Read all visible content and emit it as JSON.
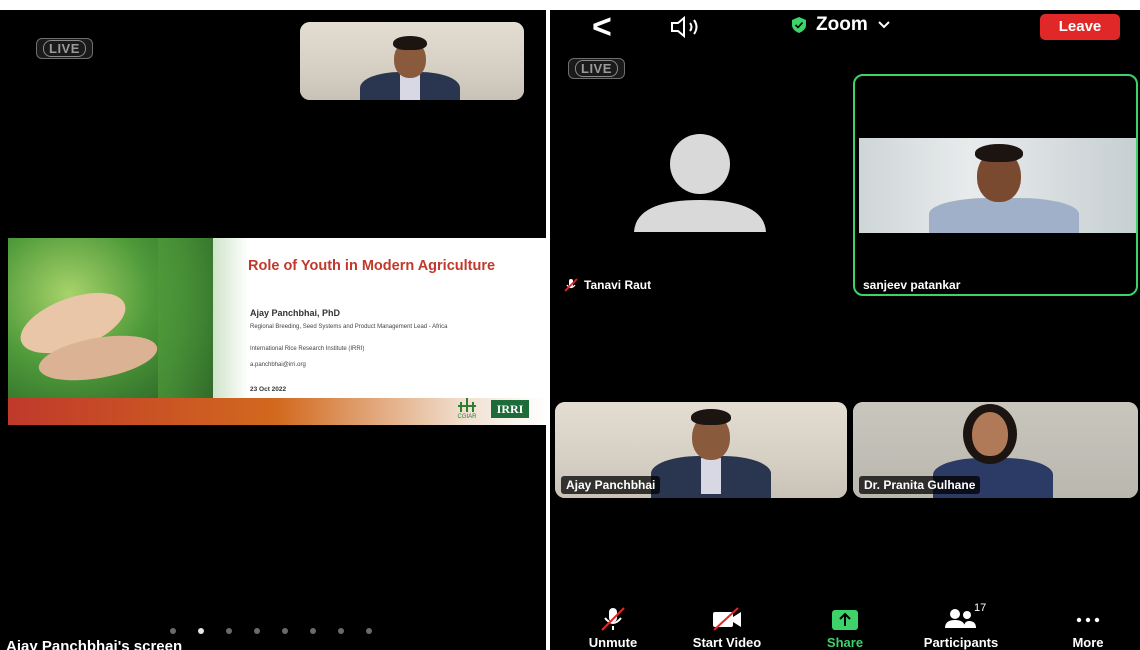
{
  "left": {
    "live_badge": "LIVE",
    "slide": {
      "title": "Role of Youth in Modern Agriculture",
      "author": "Ajay Panchbhai, PhD",
      "role": "Regional Breeding, Seed Systems and Product Management Lead - Africa",
      "institute": "International Rice Research Institute (IRRI)",
      "email": "a.panchbhai@irri.org",
      "date": "23 Oct 2022",
      "logo_cgiar": "CGIAR",
      "logo_irri": "IRRI"
    },
    "page_dots": 8,
    "active_dot": 1,
    "screen_label": "Ajay Panchbhai's screen"
  },
  "right": {
    "app_title": "Zoom",
    "leave_label": "Leave",
    "live_badge": "LIVE",
    "participants": [
      {
        "name": "Tanavi Raut",
        "muted": true,
        "video": false
      },
      {
        "name": "sanjeev patankar",
        "muted": false,
        "video": true,
        "active": true
      },
      {
        "name": "Ajay Panchbhai",
        "muted": false,
        "video": true
      },
      {
        "name": "Dr. Pranita Gulhane",
        "muted": false,
        "video": true
      }
    ],
    "toolbar": {
      "unmute": "Unmute",
      "start_video": "Start Video",
      "share": "Share",
      "participants": "Participants",
      "participant_count": "17",
      "more": "More"
    },
    "colors": {
      "leave": "#e02828",
      "active_border": "#3ed36a",
      "share": "#3ed36a"
    }
  }
}
